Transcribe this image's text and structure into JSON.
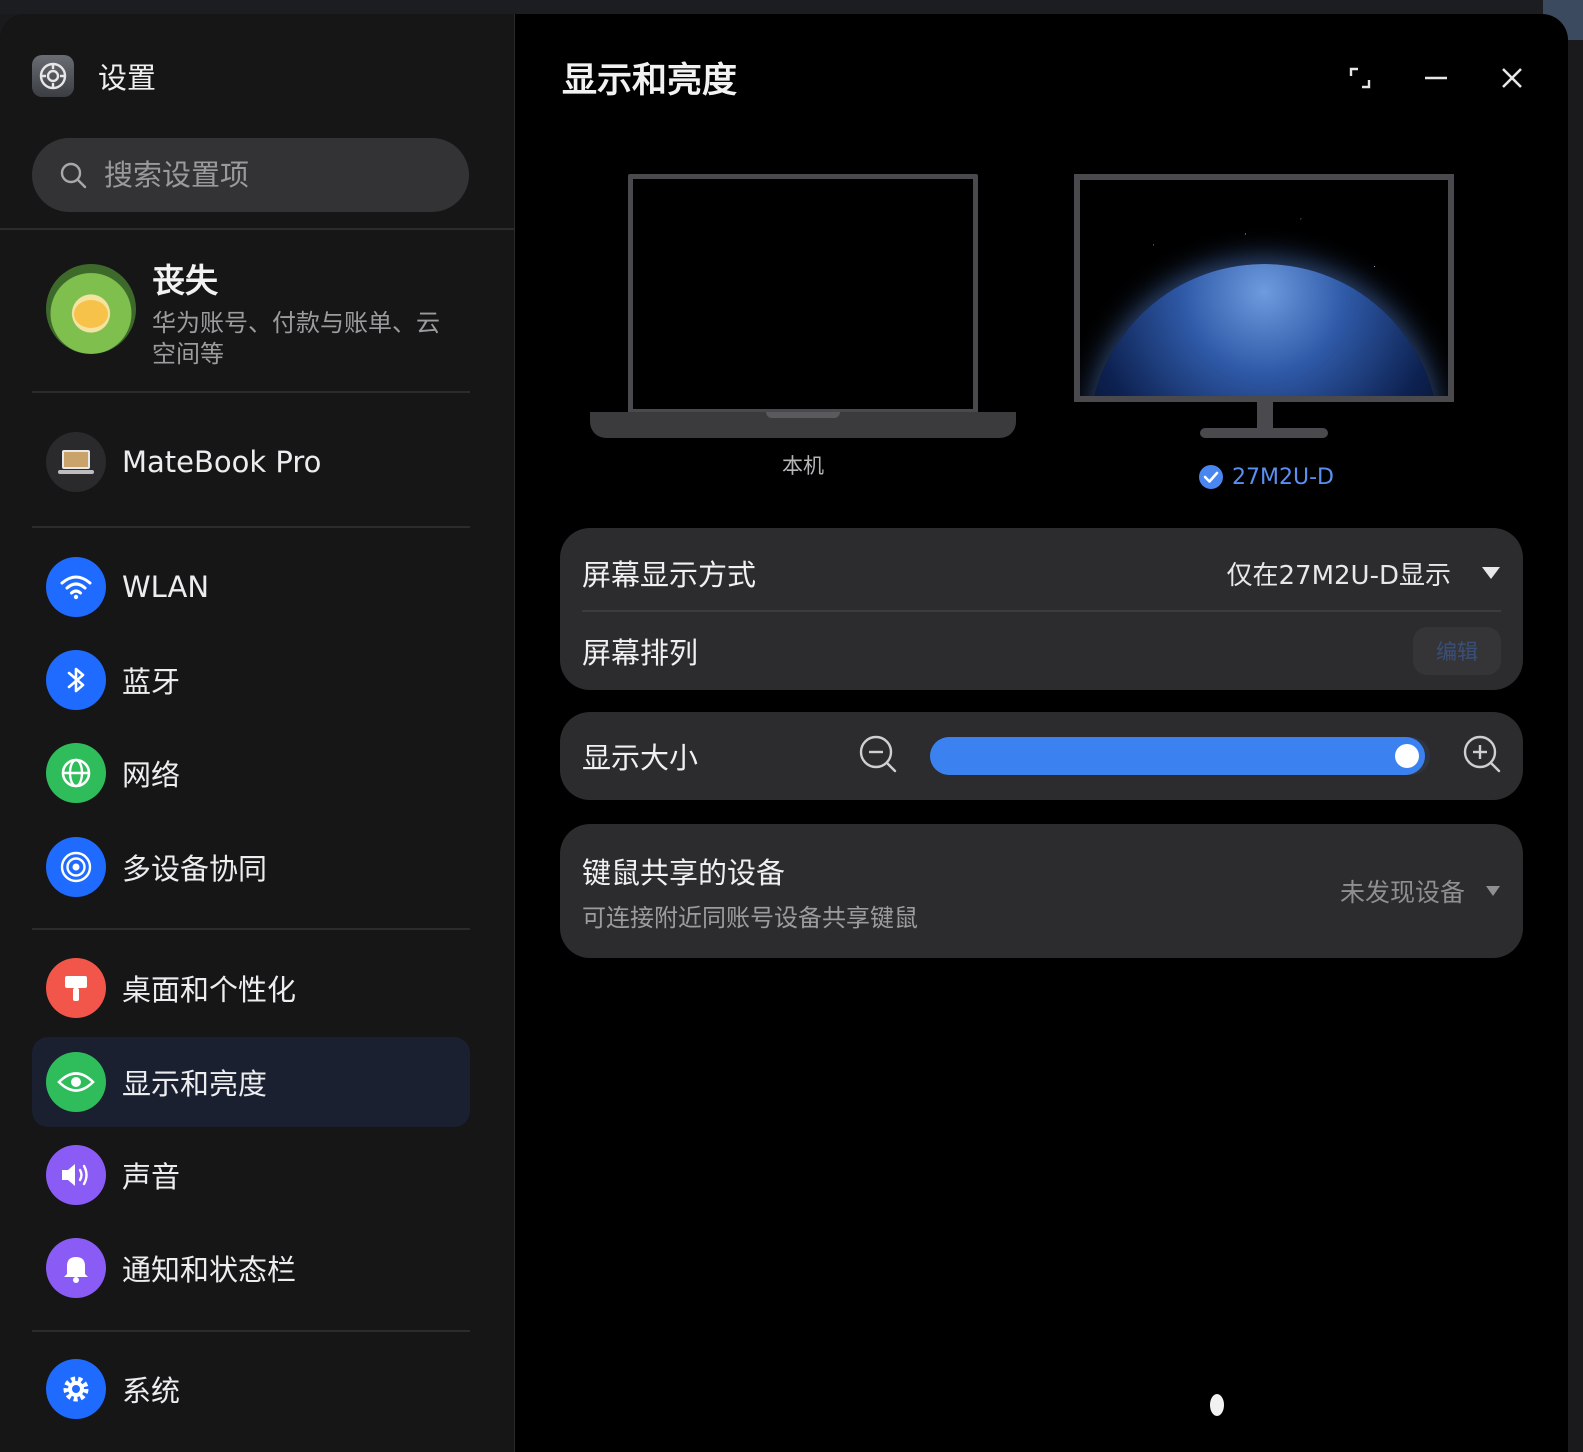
{
  "app": {
    "title": "设置",
    "icon": "gear-icon"
  },
  "search": {
    "placeholder": "搜索设置项"
  },
  "account": {
    "name": "丧失",
    "description": "华为账号、付款与账单、云空间等"
  },
  "device": {
    "label": "MateBook Pro"
  },
  "sidebar": {
    "items": [
      {
        "label": "WLAN",
        "icon": "wifi-icon",
        "color": "#1f6bff"
      },
      {
        "label": "蓝牙",
        "icon": "bluetooth-icon",
        "color": "#1f6bff"
      },
      {
        "label": "网络",
        "icon": "globe-icon",
        "color": "#2fbd5b"
      },
      {
        "label": "多设备协同",
        "icon": "multi-device-icon",
        "color": "#1f6bff"
      },
      {
        "label": "桌面和个性化",
        "icon": "brush-icon",
        "color": "#f2564a"
      },
      {
        "label": "显示和亮度",
        "icon": "eye-icon",
        "color": "#2fbd5b",
        "active": true
      },
      {
        "label": "声音",
        "icon": "speaker-icon",
        "color": "#8a5cf5"
      },
      {
        "label": "通知和状态栏",
        "icon": "bell-icon",
        "color": "#8a5cf5"
      },
      {
        "label": "系统",
        "icon": "gear-icon",
        "color": "#1f6bff"
      }
    ]
  },
  "main": {
    "title": "显示和亮度",
    "screens": {
      "local_label": "本机",
      "external_label": "27M2U-D"
    },
    "display_mode": {
      "label": "屏幕显示方式",
      "value": "仅在27M2U-D显示"
    },
    "arrangement": {
      "label": "屏幕排列",
      "button": "编辑"
    },
    "display_size": {
      "label": "显示大小",
      "level": 0.99
    },
    "kb_mouse": {
      "label": "键鼠共享的设备",
      "description": "可连接附近同账号设备共享键鼠",
      "value": "未发现设备"
    }
  },
  "colors": {
    "accent": "#3b82f0",
    "link": "#5b8ff2"
  }
}
